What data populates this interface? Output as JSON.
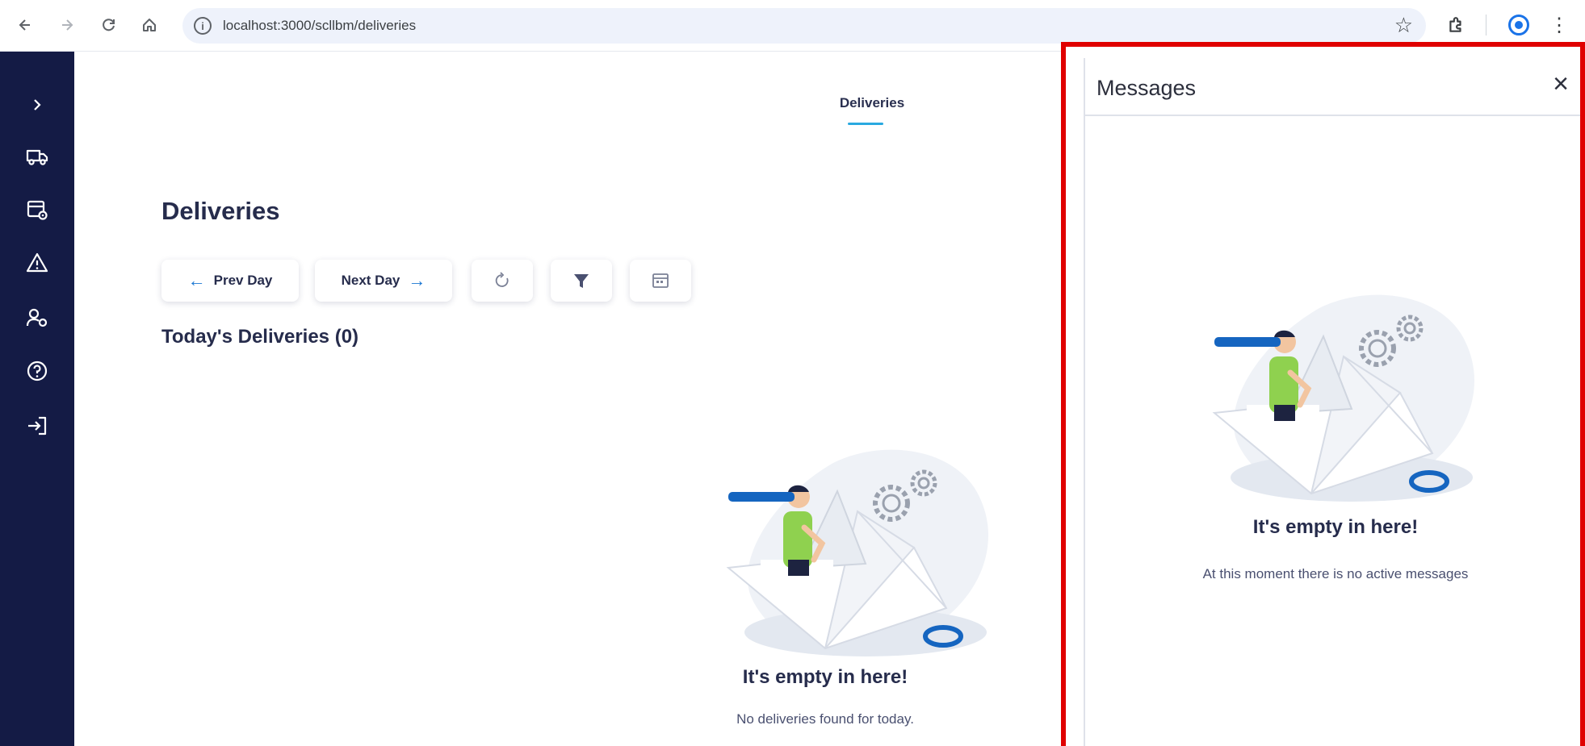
{
  "browser": {
    "url": "localhost:3000/scllbm/deliveries",
    "back_icon": "arrow-left-icon",
    "forward_icon": "arrow-right-icon",
    "reload_icon": "reload-icon",
    "home_icon": "home-icon",
    "star_icon": "star-icon",
    "extensions_icon": "puzzle-icon",
    "menu_icon": "more-vertical-icon"
  },
  "sidebar": {
    "items": [
      {
        "icon": "chevron-right-icon"
      },
      {
        "icon": "truck-icon"
      },
      {
        "icon": "calendar-settings-icon"
      },
      {
        "icon": "warning-icon"
      },
      {
        "icon": "users-icon"
      },
      {
        "icon": "help-icon"
      },
      {
        "icon": "logout-icon"
      }
    ]
  },
  "main": {
    "top_tab": "Deliveries",
    "title": "Deliveries",
    "toolbar": {
      "prev_label": "Prev Day",
      "next_label": "Next Day",
      "refresh_icon": "refresh-icon",
      "filter_icon": "filter-icon",
      "calendar_icon": "calendar-icon"
    },
    "section_title": "Today's Deliveries (0)",
    "empty_title": "It's empty in here!",
    "empty_subtitle": "No deliveries found for today."
  },
  "messages_panel": {
    "title": "Messages",
    "close_icon": "close-icon",
    "empty_title": "It's empty in here!",
    "empty_subtitle": "At this moment there is no active messages"
  },
  "colors": {
    "sidebar_bg": "#141b45",
    "accent": "#1976d2",
    "tab_underline": "#29a9e0",
    "highlight_border": "#e00000",
    "person_shirt": "#8fd14f"
  }
}
